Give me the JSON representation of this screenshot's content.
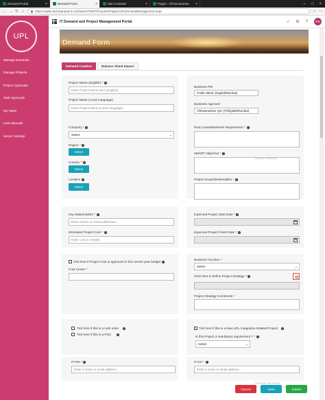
{
  "browser": {
    "tabs": [
      {
        "label": "Demand Portal",
        "active": false
      },
      {
        "label": "Demand Form",
        "active": true
      },
      {
        "label": "Site Contents",
        "active": false
      },
      {
        "label": "Pages - All Documents",
        "active": false
      }
    ],
    "url": "https://upltin.ted.sharepoint.com/sites/ITMSP/Proj-dev/Pages/UPLDemandManagement.aspx"
  },
  "app": {
    "title": "IT Demand and Project Management Portal",
    "avatar_initials": "PN",
    "logo_text": "UPL",
    "brand_color": "#cc3d6f"
  },
  "sidebar": {
    "items": [
      {
        "label": "Manage Demands"
      },
      {
        "label": "Manage Projects"
      },
      {
        "label": "Project Approvals"
      },
      {
        "label": "Task Approvals"
      },
      {
        "label": "My Tasks"
      },
      {
        "label": "User Manuals"
      },
      {
        "label": "Server Settings"
      }
    ]
  },
  "banner": {
    "title": "Demand Form"
  },
  "form_tabs": [
    {
      "label": "Demand Creation",
      "active": true
    },
    {
      "label": "Balance Sheet Impact",
      "active": false
    }
  ],
  "form": {
    "project_name_en": {
      "label": "Project Name (English)",
      "placeholder": "Enter Project Name here (English)"
    },
    "project_name_local": {
      "label": "Project Name (Local Language)",
      "placeholder": "Enter Project Name (Local Language)"
    },
    "business_pm": {
      "label": "Business PM",
      "value": "Pratik Nikam (Digital/Mumbai)"
    },
    "business_approver": {
      "label": "Business Approver",
      "value": "Vishwanathan Iyer (IT/Digital/Mumbai)"
    },
    "company": {
      "label": "Company",
      "value": "Select"
    },
    "region": {
      "label": "Region",
      "button": "Select"
    },
    "country": {
      "label": "Country",
      "button": "Select"
    },
    "location": {
      "label": "Location",
      "button": "Select"
    },
    "root_cause": {
      "label": "Root Cause/Business Requirement"
    },
    "smart_objective": {
      "label": "SMART Objective"
    },
    "project_scope": {
      "label": "Project Scope/Deliverables"
    },
    "key_stakeholders": {
      "label": "Key Stakeholders",
      "placeholder": "Enter names or email addresses..."
    },
    "estimated_cost": {
      "label": "Estimated Project Cost",
      "placeholder": "Enter cost in USD($)"
    },
    "start_date": {
      "label": "Expected Project Start Date"
    },
    "finish_date": {
      "label": "Expected Project Finish Date"
    },
    "budget_check": {
      "label": "Tick here if Project Cost is approved in the current year budget"
    },
    "cost_center": {
      "label": "Cost Center"
    },
    "business_function": {
      "label": "Business Function",
      "value": "Select"
    },
    "define_strategy": {
      "label": "Click here to define Project Strategy"
    },
    "strategy_comments": {
      "label": "Project Strategy Comments"
    },
    "rush_order": {
      "label": "Tick here if this is a rush order"
    },
    "poc": {
      "label": "Tick here if this is a POC"
    },
    "new_upl_project": {
      "label": "Tick here if this is a New UPL Integration Related Project"
    },
    "mandatory_req": {
      "label": "Is this Project a mandatory requirement ?",
      "value": "Select"
    },
    "it_pm": {
      "label": "IT PM",
      "placeholder": "Enter a name or email address..."
    },
    "it_dh": {
      "label": "IT DH",
      "placeholder": "Enter a name or email address..."
    }
  },
  "buttons": {
    "cancel": "Cancel",
    "save": "Save",
    "submit": "Submit"
  },
  "watermark": {
    "line1": "Activate Windows",
    "line2": "Go to Settings to activate Windows."
  }
}
